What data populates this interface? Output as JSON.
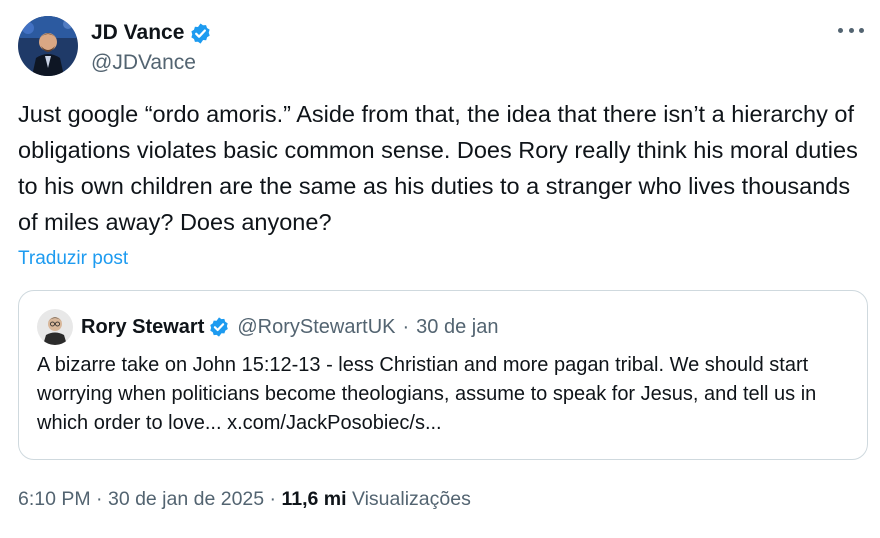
{
  "author": {
    "name": "JD Vance",
    "handle": "@JDVance",
    "avatar_icon": "jd-vance-avatar"
  },
  "tweet": {
    "text": "Just google “ordo amoris.” Aside from that, the idea that there isn’t a hierarchy of obligations violates basic common sense. Does Rory really think his moral duties to his own children are the same as his duties to a stranger who lives thousands of miles away? Does anyone?",
    "translate_label": "Traduzir post"
  },
  "quoted": {
    "name": "Rory Stewart",
    "handle": "@RoryStewartUK",
    "separator": "·",
    "date": "30 de jan",
    "text": "A bizarre take on John 15:12-13  - less Christian and more pagan tribal. We should start worrying when politicians become theologians, assume to speak for Jesus, and tell us in which order to love... x.com/JackPosobiec/s..."
  },
  "footer": {
    "time": "6:10 PM",
    "sep1": " · ",
    "date": "30 de jan de 2025",
    "sep2": " · ",
    "views_count": "11,6 mi",
    "views_label": " Visualizações"
  },
  "colors": {
    "verified_badge": "#1d9bf0",
    "link": "#1d9bf0",
    "secondary_text": "#536471",
    "border": "#cfd9de"
  }
}
